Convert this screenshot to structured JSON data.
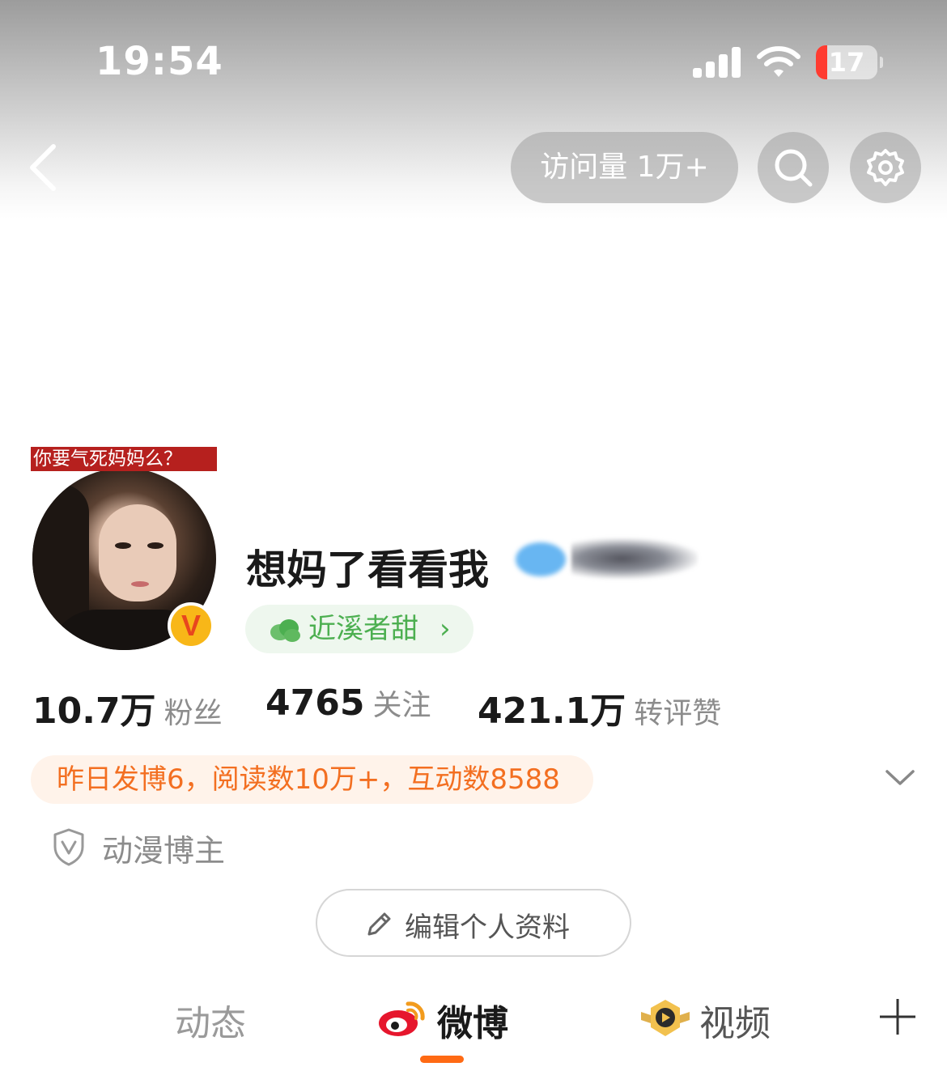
{
  "status_bar": {
    "time": "19:54",
    "battery_level": "17",
    "icons": [
      "signal-icon",
      "wifi-icon",
      "battery-icon"
    ]
  },
  "header": {
    "visits_label": "访问量 1万+",
    "icons": [
      "back-icon",
      "search-icon",
      "gear-icon"
    ]
  },
  "profile": {
    "avatar_caption": "你要气死妈妈么？",
    "verified_badge": "V",
    "username": "想妈了看看我",
    "tag_label": "近溪者甜",
    "tag_chevron": "›",
    "stats": [
      {
        "value": "10.7万",
        "label": "粉丝"
      },
      {
        "value": "4765",
        "label": "关注"
      },
      {
        "value": "421.1万",
        "label": "转评赞"
      }
    ],
    "activity_summary": "昨日发博6，阅读数10万+，互动数8588",
    "category": "动漫博主",
    "edit_button_label": "编辑个人资料"
  },
  "tabs": [
    {
      "label": "动态",
      "active": false
    },
    {
      "label": "微博",
      "active": true
    },
    {
      "label": "视频",
      "active": false
    }
  ],
  "colors": {
    "accent_orange": "#f36f21",
    "tab_indicator": "#ff6a14",
    "tag_green": "#4caf50",
    "activity_bg": "#fff3ea"
  }
}
